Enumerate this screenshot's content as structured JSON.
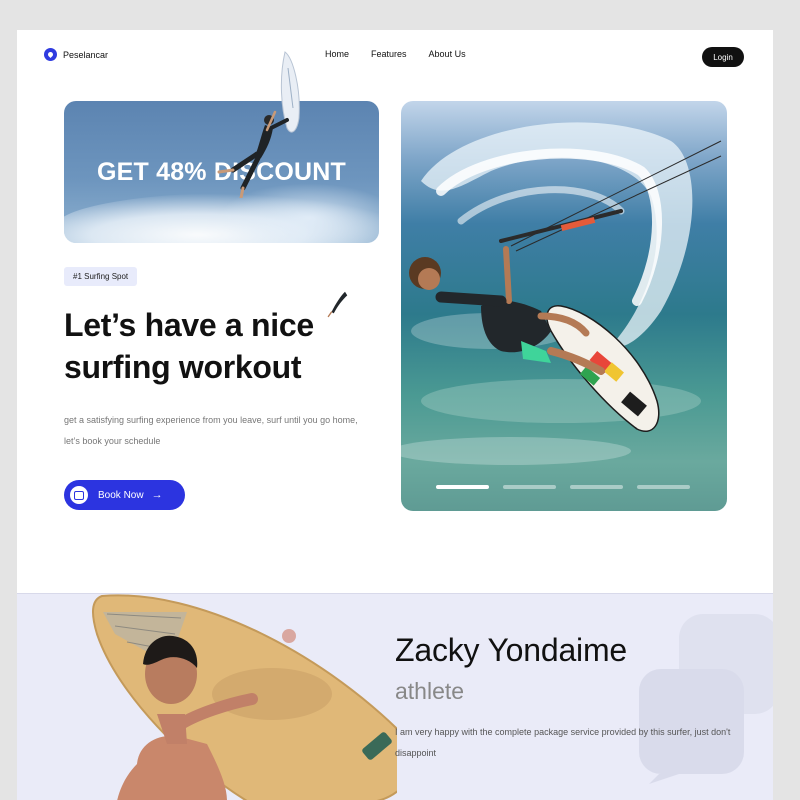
{
  "nav": {
    "brand": "Peselancar",
    "links": [
      "Home",
      "Features",
      "About Us"
    ],
    "login": "Login"
  },
  "promo": {
    "title": "GET 48% DISCOUNT"
  },
  "hero": {
    "tag": "#1 Surfing Spot",
    "headline": "Let’s have a nice surfing workout",
    "description": "get a satisfying surfing experience from you leave, surf until you go home, let’s book your schedule",
    "cta": "Book Now",
    "cta_arrow": "→",
    "slides": 4,
    "active_slide": 1
  },
  "testimonial": {
    "name": "Zacky Yondaime",
    "role": "athlete",
    "quote": "I am very happy with the complete package service provided by this surfer, just don't disappoint"
  },
  "colors": {
    "accent": "#2c34e0",
    "tag_bg": "#e8ebfb",
    "testimonial_bg": "#eaebf8"
  }
}
